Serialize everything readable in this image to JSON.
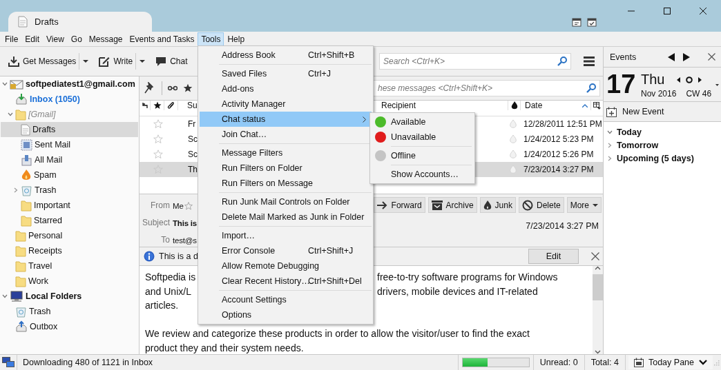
{
  "window": {
    "tab_title": "Drafts"
  },
  "menubar": [
    {
      "label": "File",
      "selected": false
    },
    {
      "label": "Edit",
      "selected": false
    },
    {
      "label": "View",
      "selected": false
    },
    {
      "label": "Go",
      "selected": false
    },
    {
      "label": "Message",
      "selected": false
    },
    {
      "label": "Events and Tasks",
      "selected": false
    },
    {
      "label": "Tools",
      "selected": true
    },
    {
      "label": "Help",
      "selected": false
    }
  ],
  "toolbar": [
    {
      "kind": "get",
      "label": "Get Messages",
      "dropdown": true
    },
    {
      "kind": "write",
      "label": "Write",
      "dropdown": true
    },
    {
      "kind": "chat",
      "label": "Chat",
      "dropdown": false
    }
  ],
  "search": {
    "placeholder": "Search <Ctrl+K>"
  },
  "folders": [
    {
      "kind": "account",
      "label": "softpediatest1@gmail.com",
      "expanded": true,
      "selected": false,
      "children": [
        {
          "kind": "inbox",
          "label": "Inbox (1050)",
          "unread": true,
          "selected": false
        },
        {
          "kind": "virtual",
          "label": "[Gmail]",
          "expanded": true,
          "selected": false,
          "children": [
            {
              "kind": "drafts",
              "label": "Drafts",
              "selected": true
            },
            {
              "kind": "sent",
              "label": "Sent Mail",
              "selected": false
            },
            {
              "kind": "allmail",
              "label": "All Mail",
              "selected": false
            },
            {
              "kind": "spam",
              "label": "Spam",
              "selected": false
            },
            {
              "kind": "trash",
              "label": "Trash",
              "expanded": false,
              "selected": false
            },
            {
              "kind": "folder",
              "label": "Important",
              "selected": false
            },
            {
              "kind": "folder",
              "label": "Starred",
              "selected": false
            }
          ]
        },
        {
          "kind": "folder",
          "label": "Personal",
          "selected": false
        },
        {
          "kind": "folder",
          "label": "Receipts",
          "selected": false
        },
        {
          "kind": "folder",
          "label": "Travel",
          "selected": false
        },
        {
          "kind": "folder",
          "label": "Work",
          "selected": false
        }
      ]
    },
    {
      "kind": "local",
      "label": "Local Folders",
      "expanded": true,
      "selected": false,
      "children": [
        {
          "kind": "trash",
          "label": "Trash",
          "selected": false
        },
        {
          "kind": "outbox",
          "label": "Outbox",
          "selected": false
        }
      ]
    }
  ],
  "quick_filter": {
    "placeholder": "hese messages <Ctrl+Shift+K>"
  },
  "thread_header": {
    "subject": "Su",
    "recipient": "Recipient",
    "date": "Date"
  },
  "messages": [
    {
      "subject": "Fr",
      "date": "12/28/2011 12:51 PM",
      "starred": false,
      "selected": false
    },
    {
      "subject": "Sc",
      "date": "1/24/2012 5:23 PM",
      "starred": false,
      "selected": false
    },
    {
      "subject": "Sc",
      "date": "1/24/2012 5:26 PM",
      "starred": false,
      "selected": false
    },
    {
      "subject": "Th",
      "date": "7/23/2014 3:27 PM",
      "starred": false,
      "selected": true
    }
  ],
  "message_header": {
    "from_label": "From",
    "from": "Me",
    "subject_label": "Subject",
    "subject": "This is",
    "to_label": "To",
    "to": "test@s",
    "date": "7/23/2014 3:27 PM",
    "buttons": [
      {
        "kind": "forward",
        "label": "Forward"
      },
      {
        "kind": "archive",
        "label": "Archive"
      },
      {
        "kind": "junk",
        "label": "Junk"
      },
      {
        "kind": "delete",
        "label": "Delete"
      },
      {
        "kind": "more",
        "label": "More"
      }
    ]
  },
  "notification": {
    "text": "This is a d",
    "button": "Edit"
  },
  "body_lines": [
    {
      "kind": "text",
      "left": "Softpedia is",
      "right": "free-to-try software programs for Windows"
    },
    {
      "kind": "text",
      "left": "and Unix/L",
      "right": "drivers, mobile devices and IT-related"
    },
    {
      "kind": "text",
      "left": "articles."
    },
    {
      "kind": "blank"
    },
    {
      "kind": "text",
      "left": "We review and categorize these products in order to allow the visitor/user to find the exact"
    },
    {
      "kind": "text",
      "left": "product they and their system needs."
    }
  ],
  "menu": [
    {
      "kind": "item",
      "label": "Address Book",
      "shortcut": "Ctrl+Shift+B",
      "selected": false,
      "submenu": false
    },
    {
      "kind": "separator"
    },
    {
      "kind": "item",
      "label": "Saved Files",
      "shortcut": "Ctrl+J",
      "selected": false,
      "submenu": false
    },
    {
      "kind": "item",
      "label": "Add-ons",
      "selected": false,
      "submenu": false
    },
    {
      "kind": "item",
      "label": "Activity Manager",
      "selected": false,
      "submenu": false
    },
    {
      "kind": "item",
      "label": "Chat status",
      "selected": true,
      "submenu": true
    },
    {
      "kind": "item",
      "label": "Join Chat…",
      "selected": false,
      "submenu": false
    },
    {
      "kind": "separator"
    },
    {
      "kind": "item",
      "label": "Message Filters",
      "selected": false,
      "submenu": false
    },
    {
      "kind": "item",
      "label": "Run Filters on Folder",
      "selected": false,
      "submenu": false
    },
    {
      "kind": "item",
      "label": "Run Filters on Message",
      "selected": false,
      "submenu": false
    },
    {
      "kind": "separator"
    },
    {
      "kind": "item",
      "label": "Run Junk Mail Controls on Folder",
      "selected": false,
      "submenu": false
    },
    {
      "kind": "item",
      "label": "Delete Mail Marked as Junk in Folder",
      "selected": false,
      "submenu": false
    },
    {
      "kind": "separator"
    },
    {
      "kind": "item",
      "label": "Import…",
      "selected": false,
      "submenu": false
    },
    {
      "kind": "item",
      "label": "Error Console",
      "shortcut": "Ctrl+Shift+J",
      "selected": false,
      "submenu": false
    },
    {
      "kind": "item",
      "label": "Allow Remote Debugging",
      "selected": false,
      "submenu": false
    },
    {
      "kind": "item",
      "label": "Clear Recent History…",
      "shortcut": "Ctrl+Shift+Del",
      "selected": false,
      "submenu": false
    },
    {
      "kind": "separator"
    },
    {
      "kind": "item",
      "label": "Account Settings",
      "selected": false,
      "submenu": false
    },
    {
      "kind": "item",
      "label": "Options",
      "selected": false,
      "submenu": false
    }
  ],
  "submenu": [
    {
      "kind": "status",
      "label": "Available",
      "color": "#4cbb2a"
    },
    {
      "kind": "status",
      "label": "Unavailable",
      "color": "#e01c1c"
    },
    {
      "kind": "separator"
    },
    {
      "kind": "status",
      "label": "Offline",
      "color": "#c4c4c4"
    },
    {
      "kind": "separator"
    },
    {
      "kind": "item",
      "label": "Show Accounts…"
    }
  ],
  "today_pane": {
    "title": "Events",
    "day": "17",
    "weekday": "Thu",
    "month_year": "Nov 2016",
    "week": "CW 46",
    "new_event": "New Event",
    "sections": [
      {
        "label": "Today",
        "expanded": true
      },
      {
        "label": "Tomorrow",
        "expanded": false
      },
      {
        "label": "Upcoming (5 days)",
        "expanded": false
      }
    ]
  },
  "status_bar": {
    "message": "Downloading 480 of 1121 in Inbox",
    "progress": {
      "level": 0.38
    },
    "unread": "Unread: 0",
    "total": "Total: 4",
    "today_pane_button": "Today Pane"
  }
}
